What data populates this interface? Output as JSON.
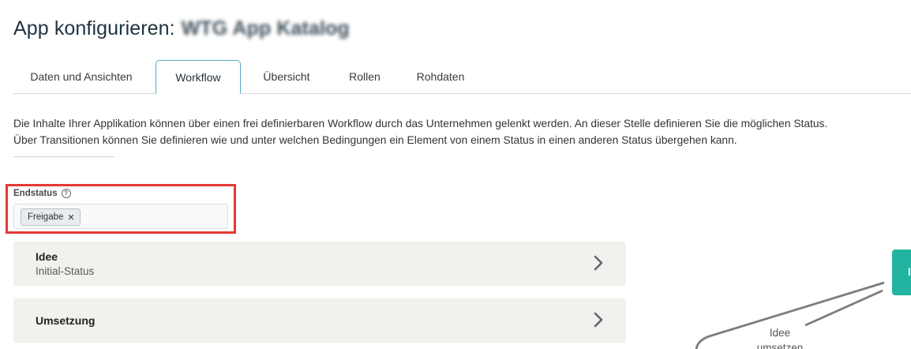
{
  "header": {
    "title_prefix": "App konfigurieren:",
    "app_name": "WTG App Katalog"
  },
  "tabs": [
    {
      "label": "Daten und Ansichten",
      "active": false
    },
    {
      "label": "Workflow",
      "active": true
    },
    {
      "label": "Übersicht",
      "active": false
    },
    {
      "label": "Rollen",
      "active": false
    },
    {
      "label": "Rohdaten",
      "active": false
    }
  ],
  "description": {
    "line1": "Die Inhalte Ihrer Applikation können über einen frei definierbaren Workflow durch das Unternehmen gelenkt werden. An dieser Stelle definieren Sie die möglichen Status.",
    "line2": "Über Transitionen können Sie definieren wie und unter welchen Bedingungen ein Element von einem Status in einen anderen Status übergehen kann."
  },
  "endstatus": {
    "label": "Endstatus",
    "help_icon": "question-circle-icon",
    "chips": [
      {
        "label": "Freigabe",
        "remove_icon": "close-icon"
      }
    ]
  },
  "statuses": [
    {
      "name": "Idee",
      "subtitle": "Initial-Status",
      "icon": "chevron-right-icon"
    },
    {
      "name": "Umsetzung",
      "subtitle": "",
      "icon": "chevron-right-icon"
    }
  ],
  "diagram": {
    "node_button_label": "I",
    "transition_label_line1": "Idee",
    "transition_label_line2": "umsetzen"
  },
  "colors": {
    "accent_tab_border": "#5aa9c9",
    "highlight_red": "#e53935",
    "teal_button": "#23b3a1",
    "card_background": "#f3f1ee"
  }
}
